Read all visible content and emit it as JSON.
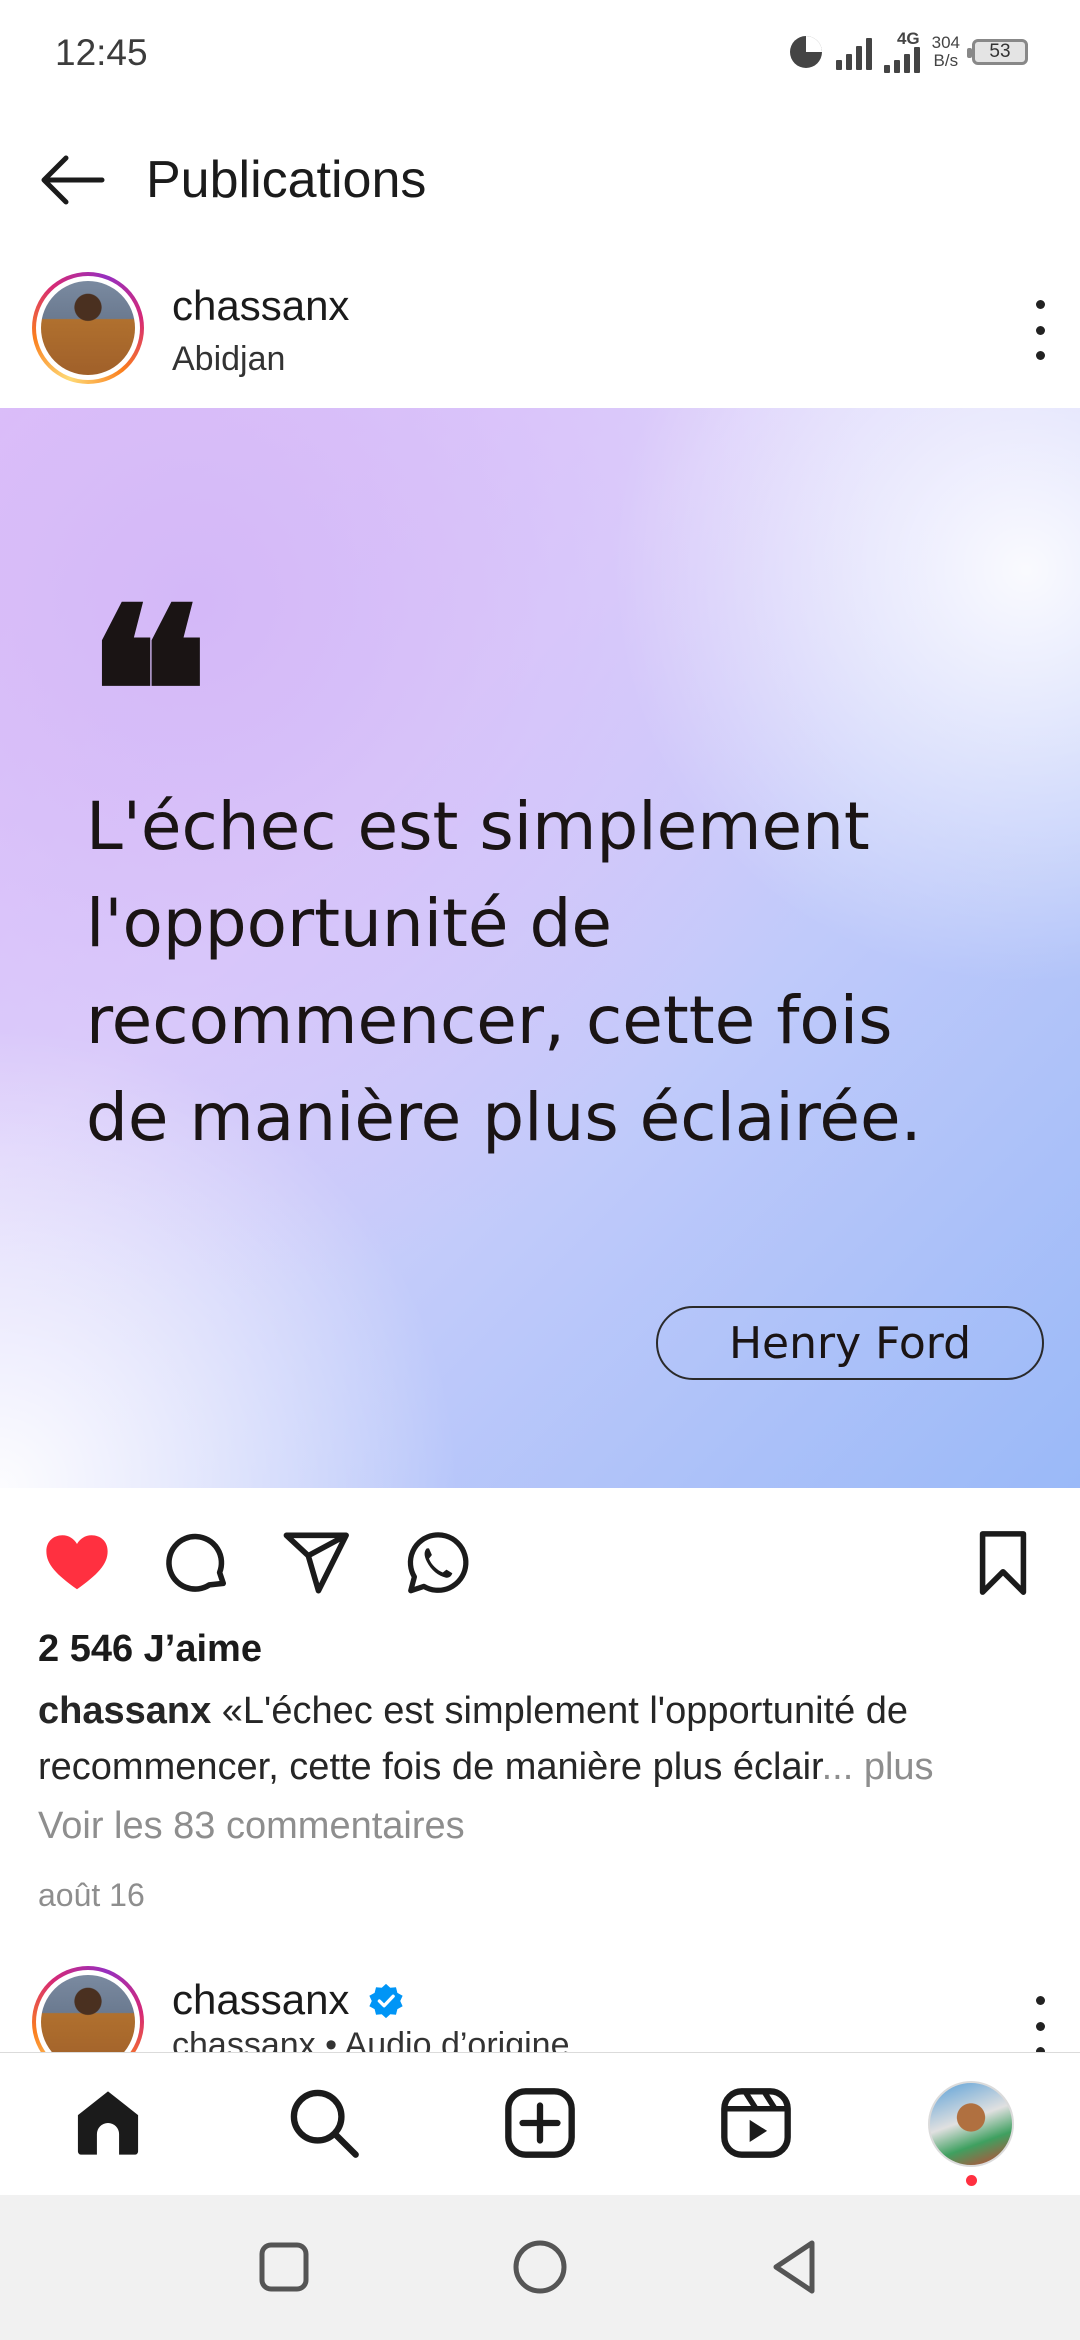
{
  "status_bar": {
    "time": "12:45",
    "network_type": "4G",
    "speed_value": "304",
    "speed_unit": "B/s",
    "battery": "53"
  },
  "header": {
    "title": "Publications",
    "back_icon": "arrow-left-icon"
  },
  "post": {
    "username": "chassanx",
    "location": "Abidjan",
    "image": {
      "quote_mark": "❝",
      "quote": "L'échec est simplement l'opportunité de recommencer, cette fois de manière plus éclairée.",
      "author": "Henry Ford"
    },
    "likes": "2 546 J’aime",
    "caption_user": "chassanx",
    "caption_text": " «L'échec est simplement l'opportunité de recommencer, cette fois de manière plus éclair",
    "caption_more": "... plus",
    "comments_link": "Voir les 83 commentaires",
    "date": "août 16",
    "liked": true,
    "like_color": "#ff3040"
  },
  "next_post": {
    "username": "chassanx",
    "subtitle": "chassanx • Audio d’origine"
  },
  "bottom_nav": {
    "items": [
      "home-icon",
      "search-icon",
      "create-icon",
      "reels-icon",
      "profile-avatar"
    ]
  },
  "system_nav": [
    "recent-apps-icon",
    "home-circle-icon",
    "back-triangle-icon"
  ]
}
